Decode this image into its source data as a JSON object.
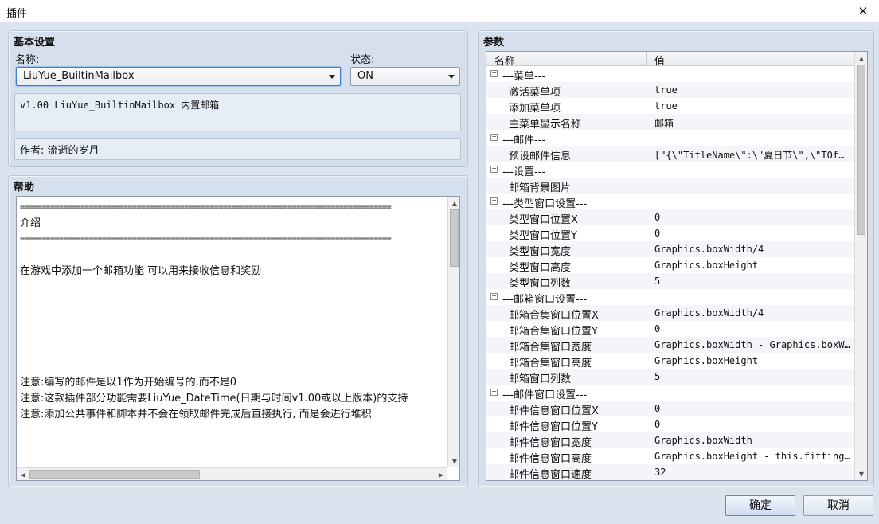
{
  "window": {
    "title": "插件",
    "close_glyph": "✕"
  },
  "basic": {
    "title": "基本设置",
    "name_label": "名称:",
    "name_value": "LiuYue_BuiltinMailbox",
    "status_label": "状态:",
    "status_value": "ON",
    "description": "v1.00 LiuYue_BuiltinMailbox 内置邮箱",
    "author": "作者: 流逝的岁月"
  },
  "help": {
    "title": "帮助",
    "lines": [
      "======================================================================================",
      "介绍",
      "======================================================================================",
      "",
      "在游戏中添加一个邮箱功能 可以用来接收信息和奖励",
      "",
      "",
      "",
      "",
      "",
      "",
      "注意:编写的邮件是以1作为开始编号的,而不是0",
      "注意:这款插件部分功能需要LiuYue_DateTime(日期与时间v1.00或以上版本)的支持",
      "注意:添加公共事件和脚本并不会在领取邮件完成后直接执行, 而是会进行堆积"
    ]
  },
  "params": {
    "title": "参数",
    "col_name": "名称",
    "col_value": "值",
    "rows": [
      {
        "type": "cat",
        "name": "---菜单---",
        "value": ""
      },
      {
        "type": "item",
        "name": "激活菜单项",
        "value": "true"
      },
      {
        "type": "item",
        "name": "添加菜单项",
        "value": "true"
      },
      {
        "type": "item",
        "name": "主菜单显示名称",
        "value": "邮箱"
      },
      {
        "type": "cat",
        "name": "---邮件---",
        "value": ""
      },
      {
        "type": "item",
        "name": "预设邮件信息",
        "value": "[\"{\\\"TitleName\\\":\\\"夏日节\\\",\\\"TOf…"
      },
      {
        "type": "cat",
        "name": "---设置---",
        "value": ""
      },
      {
        "type": "item",
        "name": "邮箱背景图片",
        "value": ""
      },
      {
        "type": "cat",
        "name": "---类型窗口设置---",
        "value": ""
      },
      {
        "type": "item",
        "name": "类型窗口位置X",
        "value": "0"
      },
      {
        "type": "item",
        "name": "类型窗口位置Y",
        "value": "0"
      },
      {
        "type": "item",
        "name": "类型窗口宽度",
        "value": "Graphics.boxWidth/4"
      },
      {
        "type": "item",
        "name": "类型窗口高度",
        "value": "Graphics.boxHeight"
      },
      {
        "type": "item",
        "name": "类型窗口列数",
        "value": "5"
      },
      {
        "type": "cat",
        "name": "---邮箱窗口设置---",
        "value": ""
      },
      {
        "type": "item",
        "name": "邮箱合集窗口位置X",
        "value": "Graphics.boxWidth/4"
      },
      {
        "type": "item",
        "name": "邮箱合集窗口位置Y",
        "value": "0"
      },
      {
        "type": "item",
        "name": "邮箱合集窗口宽度",
        "value": "Graphics.boxWidth - Graphics.boxWi…"
      },
      {
        "type": "item",
        "name": "邮箱合集窗口高度",
        "value": "Graphics.boxHeight"
      },
      {
        "type": "item",
        "name": "邮箱窗口列数",
        "value": "5"
      },
      {
        "type": "cat",
        "name": "---邮件窗口设置---",
        "value": ""
      },
      {
        "type": "item",
        "name": "邮件信息窗口位置X",
        "value": "0"
      },
      {
        "type": "item",
        "name": "邮件信息窗口位置Y",
        "value": "0"
      },
      {
        "type": "item",
        "name": "邮件信息窗口宽度",
        "value": "Graphics.boxWidth"
      },
      {
        "type": "item",
        "name": "邮件信息窗口高度",
        "value": "Graphics.boxHeight - this.fittingH…"
      },
      {
        "type": "item",
        "name": "邮件信息窗口速度",
        "value": "32"
      }
    ]
  },
  "buttons": {
    "ok": "确定",
    "cancel": "取消"
  },
  "icons": {
    "collapse": "minus-box-icon",
    "dropdown": "chevron-down-icon"
  }
}
